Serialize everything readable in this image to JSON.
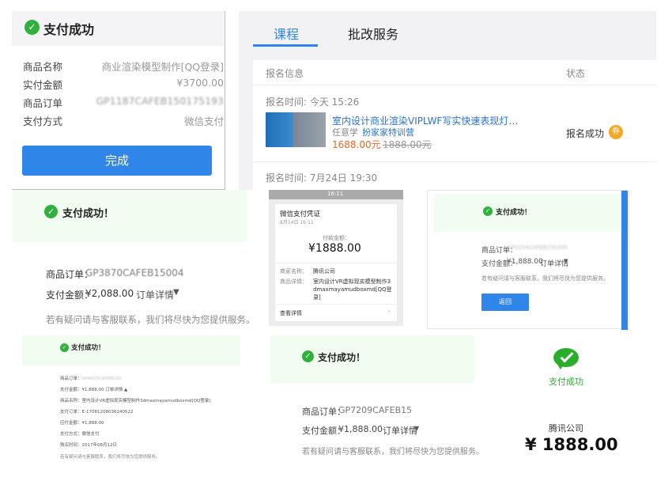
{
  "panel_a": {
    "title": "支付成功",
    "rows": [
      {
        "label": "商品名称",
        "value": "商业渲染模型制作[QQ登录]"
      },
      {
        "label": "实付金额",
        "value": "¥3700.00"
      },
      {
        "label": "商品订单",
        "value": "GP1187CAFEB150175193"
      },
      {
        "label": "支付方式",
        "value": "微信支付"
      }
    ],
    "done_button": "完成"
  },
  "panel_b": {
    "tabs": [
      "课程",
      "批改服务"
    ],
    "header_info": "报名信息",
    "header_status": "状态",
    "entry1_time": "报名时间: 今天 15:26",
    "entry1_title": "室内设计商业渲染VIPLWF写实快速表现灯…",
    "entry1_author": "任意学",
    "entry1_tag": "扮家家特训营",
    "entry1_price": "1688.00元",
    "entry1_orig_price": "1888.00元",
    "entry1_status": "报名成功",
    "entry1_badge": "券",
    "entry2_time": "报名时间: 7月24日 19:30"
  },
  "panel_c": {
    "title": "支付成功！",
    "order_label": "商品订单：",
    "order_value": "GP3870CAFEB15004",
    "amount_label": "支付金额：",
    "amount_value": "¥2,088.00",
    "detail_link": "订单详情",
    "contact_note": "若有疑问请与客服联系，我们将尽快为您提供服务。"
  },
  "panel_d": {
    "clock": "16:11",
    "title": "微信支付凭证",
    "date": "8月14日 16:11",
    "pay_label": "付款金额：",
    "pay_amount": "¥1888.00",
    "merchant_label": "商家名称：",
    "merchant_value": "腾讯公司",
    "detail_label": "商品详情：",
    "detail_value": "室内设计VR虚拟现实模型制作3dmaxmayamudboxmd[QQ登录]",
    "view_details": "查看详情"
  },
  "panel_e": {
    "title": "支付成功！",
    "order_label": "商品订单：",
    "order_value": "GP5254CAFEB150305",
    "amount_label": "支付金额：",
    "amount_value": "¥1,888.00",
    "detail_link": "订单详情",
    "contact_note": "若有疑问请与客服联系，我们将尽快为您提供服务。",
    "back_button": "返回"
  },
  "panel_f": {
    "title": "支付成功！",
    "rows": [
      {
        "label": "商品订单：",
        "value": "GP4935CAFEB150"
      },
      {
        "label": "支付金额：",
        "value": "¥1,888.00  订单详情 ▲"
      },
      {
        "label": "商品名称：",
        "value": "室内设计VR虚拟现实模型制作3dmaxmayamudboxmd[QQ登录]"
      },
      {
        "label": "支付订单：",
        "value": "E-17081208036240522"
      },
      {
        "label": "应付金额：",
        "value": "¥1,888.00"
      },
      {
        "label": "支付方式：",
        "value": "微信支付"
      },
      {
        "label": "购买时间：",
        "value": "2017年08月12日"
      }
    ],
    "contact_note": "若有疑问请与客服联系，我们将尽快为您提供服务。"
  },
  "panel_g": {
    "title": "支付成功！",
    "order_label": "商品订单：",
    "order_value": "GP7209CAFEB15",
    "amount_label": "支付金额：",
    "amount_value": "¥1,888.00",
    "detail_link": "订单详情",
    "contact_note": "若有疑问请与客服联系，我们将尽快为您提供服务。"
  },
  "panel_h": {
    "status": "支付成功",
    "merchant": "腾讯公司",
    "amount": "¥ 1888.00"
  },
  "colors": {
    "success_green": "#2fb13c",
    "primary_blue": "#2f86e8",
    "price_orange": "#e8661e",
    "link_blue": "#2a72c8",
    "badge_orange": "#f5a623"
  },
  "icons": {
    "success": "check-circle-icon",
    "dropdown": "triangle-down-icon",
    "wechat": "wechat-icon",
    "arrow": "chevron-right-icon"
  }
}
